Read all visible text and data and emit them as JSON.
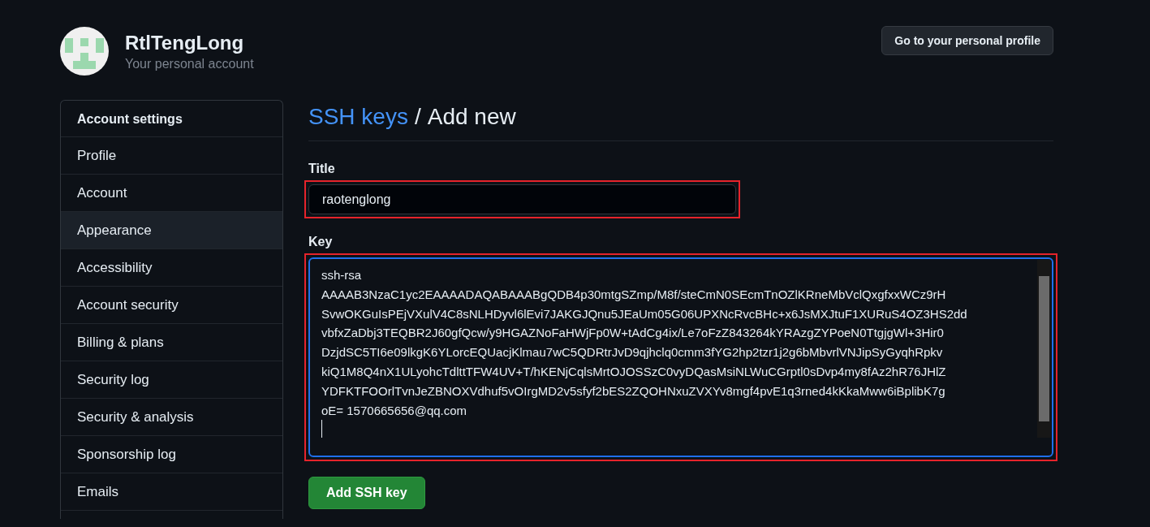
{
  "account": {
    "name": "RtlTengLong",
    "subtitle": "Your personal account",
    "profile_button": "Go to your personal profile"
  },
  "sidebar": {
    "heading": "Account settings",
    "items": [
      {
        "label": "Profile",
        "selected": false
      },
      {
        "label": "Account",
        "selected": false
      },
      {
        "label": "Appearance",
        "selected": true
      },
      {
        "label": "Accessibility",
        "selected": false
      },
      {
        "label": "Account security",
        "selected": false
      },
      {
        "label": "Billing & plans",
        "selected": false
      },
      {
        "label": "Security log",
        "selected": false
      },
      {
        "label": "Security & analysis",
        "selected": false
      },
      {
        "label": "Sponsorship log",
        "selected": false
      },
      {
        "label": "Emails",
        "selected": false
      }
    ]
  },
  "page": {
    "breadcrumb_link": "SSH keys",
    "separator": "/",
    "title": "Add new"
  },
  "form": {
    "title_label": "Title",
    "title_value": "raotenglong",
    "title_highlighted": true,
    "key_label": "Key",
    "key_highlighted": true,
    "key_lines": [
      "ssh-rsa",
      "AAAAB3NzaC1yc2EAAAADAQABAAABgQDB4p30mtgSZmp/M8f/steCmN0SEcmTnOZlKRneMbVclQxgfxxWCz9rH",
      "SvwOKGuIsPEjVXulV4C8sNLHDyvl6lEvi7JAKGJQnu5JEaUm05G06UPXNcRvcBHc+x6JsMXJtuF1XURuS4OZ3HS2dd",
      "vbfxZaDbj3TEQBR2J60gfQcw/y9HGAZNoFaHWjFp0W+tAdCg4ix/Le7oFzZ843264kYRAzgZYPoeN0TtgjgWl+3Hir0",
      "DzjdSC5TI6e09lkgK6YLorcEQUacjKlmau7wC5QDRtrJvD9qjhclq0cmm3fYG2hp2tzr1j2g6bMbvrlVNJipSyGyqhRpkv",
      "kiQ1M8Q4nX1ULyohcTdlttTFW4UV+T/hKENjCqlsMrtOJOSSzC0vyDQasMsiNLWuCGrptl0sDvp4my8fAz2hR76JHlZ",
      "YDFKTFOOrlTvnJeZBNOXVdhuf5vOIrgMD2v5sfyf2bES2ZQOHNxuZVXYv8mgf4pvE1q3rned4kKkaMww6iBplibK7g",
      "oE= 1570665656@qq.com"
    ],
    "submit": "Add SSH key"
  }
}
